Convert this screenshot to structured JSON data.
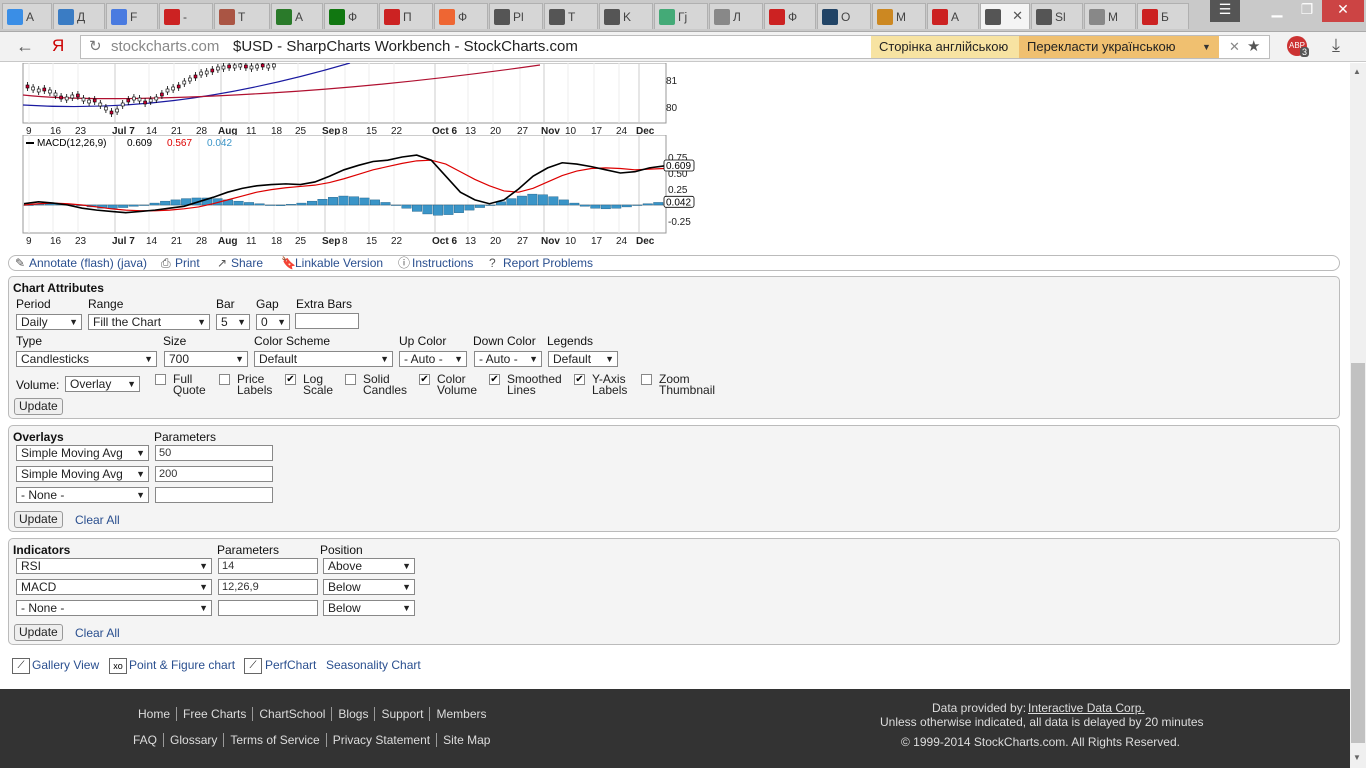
{
  "tabs": [
    {
      "label": "A",
      "color": "#3a8ee6"
    },
    {
      "label": "Д",
      "color": "#3a7cc4"
    },
    {
      "label": "F",
      "color": "#4a7be0"
    },
    {
      "label": "-",
      "color": "#c22"
    },
    {
      "label": "T",
      "color": "#a54"
    },
    {
      "label": "A",
      "color": "#2a7a2a"
    },
    {
      "label": "Ф",
      "color": "#171"
    },
    {
      "label": "П",
      "color": "#c22"
    },
    {
      "label": "Ф",
      "color": "#e63"
    },
    {
      "label": "Pl",
      "color": "#555"
    },
    {
      "label": "T",
      "color": "#555"
    },
    {
      "label": "K",
      "color": "#555"
    },
    {
      "label": "Гј",
      "color": "#4a7"
    },
    {
      "label": "Л",
      "color": "#888"
    },
    {
      "label": "Ф",
      "color": "#c22"
    },
    {
      "label": "O",
      "color": "#246"
    },
    {
      "label": "M",
      "color": "#c82"
    },
    {
      "label": "A",
      "color": "#c22"
    },
    {
      "label": "",
      "color": "#555"
    },
    {
      "label": "Sl",
      "color": "#555"
    },
    {
      "label": "M",
      "color": "#888"
    },
    {
      "label": "Б",
      "color": "#c22"
    }
  ],
  "browser": {
    "domain": "stockcharts.com",
    "title": "$USD - SharpCharts Workbench - StockCharts.com",
    "translate_page": "Сторінка англійською",
    "translate_to": "Перекласти українською",
    "abp_badge": "3"
  },
  "price_chart": {
    "y_ticks": [
      "81",
      "80"
    ],
    "x_ticks": [
      "9",
      "16",
      "23",
      "Jul 7",
      "14",
      "21",
      "28",
      "Aug",
      "11",
      "18",
      "25",
      "Sep",
      "8",
      "15",
      "22",
      "Oct 6",
      "13",
      "20",
      "27",
      "Nov",
      "10",
      "17",
      "24",
      "Dec"
    ]
  },
  "macd_chart": {
    "legend": "MACD(12,26,9)",
    "macd_value": "0.609",
    "signal_value": "0.567",
    "hist_value": "0.042",
    "y_ticks": [
      "0.75",
      "0.50",
      "0.25",
      "-0.25"
    ],
    "x_ticks": [
      "9",
      "16",
      "23",
      "Jul 7",
      "14",
      "21",
      "28",
      "Aug",
      "11",
      "18",
      "25",
      "Sep",
      "8",
      "15",
      "22",
      "Oct 6",
      "13",
      "20",
      "27",
      "Nov",
      "10",
      "17",
      "24",
      "Dec"
    ]
  },
  "actions": [
    "Annotate (flash) (java)",
    "Print",
    "Share",
    "Linkable Version",
    "Instructions",
    "Report Problems"
  ],
  "chart_attributes": {
    "title": "Chart Attributes",
    "period_label": "Period",
    "period": "Daily",
    "range_label": "Range",
    "range": "Fill the Chart",
    "bar_label": "Bar",
    "bar": "5",
    "gap_label": "Gap",
    "gap": "0",
    "extra_bars_label": "Extra Bars",
    "extra_bars": "",
    "type_label": "Type",
    "type": "Candlesticks",
    "size_label": "Size",
    "size": "700",
    "scheme_label": "Color Scheme",
    "scheme": "Default",
    "up_label": "Up Color",
    "up": "- Auto -",
    "down_label": "Down Color",
    "down": "- Auto -",
    "legends_label": "Legends",
    "legends": "Default",
    "volume_label": "Volume:",
    "volume": "Overlay",
    "checkboxes": [
      {
        "l1": "Full",
        "l2": "Quote",
        "checked": false
      },
      {
        "l1": "Price",
        "l2": "Labels",
        "checked": false
      },
      {
        "l1": "Log",
        "l2": "Scale",
        "checked": true
      },
      {
        "l1": "Solid",
        "l2": "Candles",
        "checked": false
      },
      {
        "l1": "Color",
        "l2": "Volume",
        "checked": true
      },
      {
        "l1": "Smoothed",
        "l2": "Lines",
        "checked": true
      },
      {
        "l1": "Y-Axis",
        "l2": "Labels",
        "checked": true
      },
      {
        "l1": "Zoom",
        "l2": "Thumbnail",
        "checked": false
      }
    ],
    "update": "Update"
  },
  "overlays": {
    "title": "Overlays",
    "params_label": "Parameters",
    "rows": [
      {
        "type": "Simple Moving Avg",
        "param": "50"
      },
      {
        "type": "Simple Moving Avg",
        "param": "200"
      },
      {
        "type": "- None -",
        "param": ""
      }
    ],
    "update": "Update",
    "clear": "Clear All"
  },
  "indicators": {
    "title": "Indicators",
    "params_label": "Parameters",
    "position_label": "Position",
    "rows": [
      {
        "type": "RSI",
        "param": "14",
        "pos": "Above"
      },
      {
        "type": "MACD",
        "param": "12,26,9",
        "pos": "Below"
      },
      {
        "type": "- None -",
        "param": "",
        "pos": "Below"
      }
    ],
    "update": "Update",
    "clear": "Clear All"
  },
  "chart_links": [
    "Gallery View",
    "Point & Figure chart",
    "PerfChart",
    "Seasonality Chart"
  ],
  "footer": {
    "row1": [
      "Home",
      "Free Charts",
      "ChartSchool",
      "Blogs",
      "Support",
      "Members"
    ],
    "row2": [
      "FAQ",
      "Glossary",
      "Terms of Service",
      "Privacy Statement",
      "Site Map"
    ],
    "data_by": "Data provided by:",
    "data_provider": "Interactive Data Corp.",
    "delay": "Unless otherwise indicated, all data is delayed by 20 minutes",
    "copyright": "© 1999-2014 StockCharts.com. All Rights Reserved."
  },
  "colors": {
    "link": "#2a4f8f",
    "macd": "#000000",
    "signal": "#dd0000",
    "hist": "#3a95c8",
    "sma50": "#1a1aa0",
    "sma200": "#b01030"
  }
}
